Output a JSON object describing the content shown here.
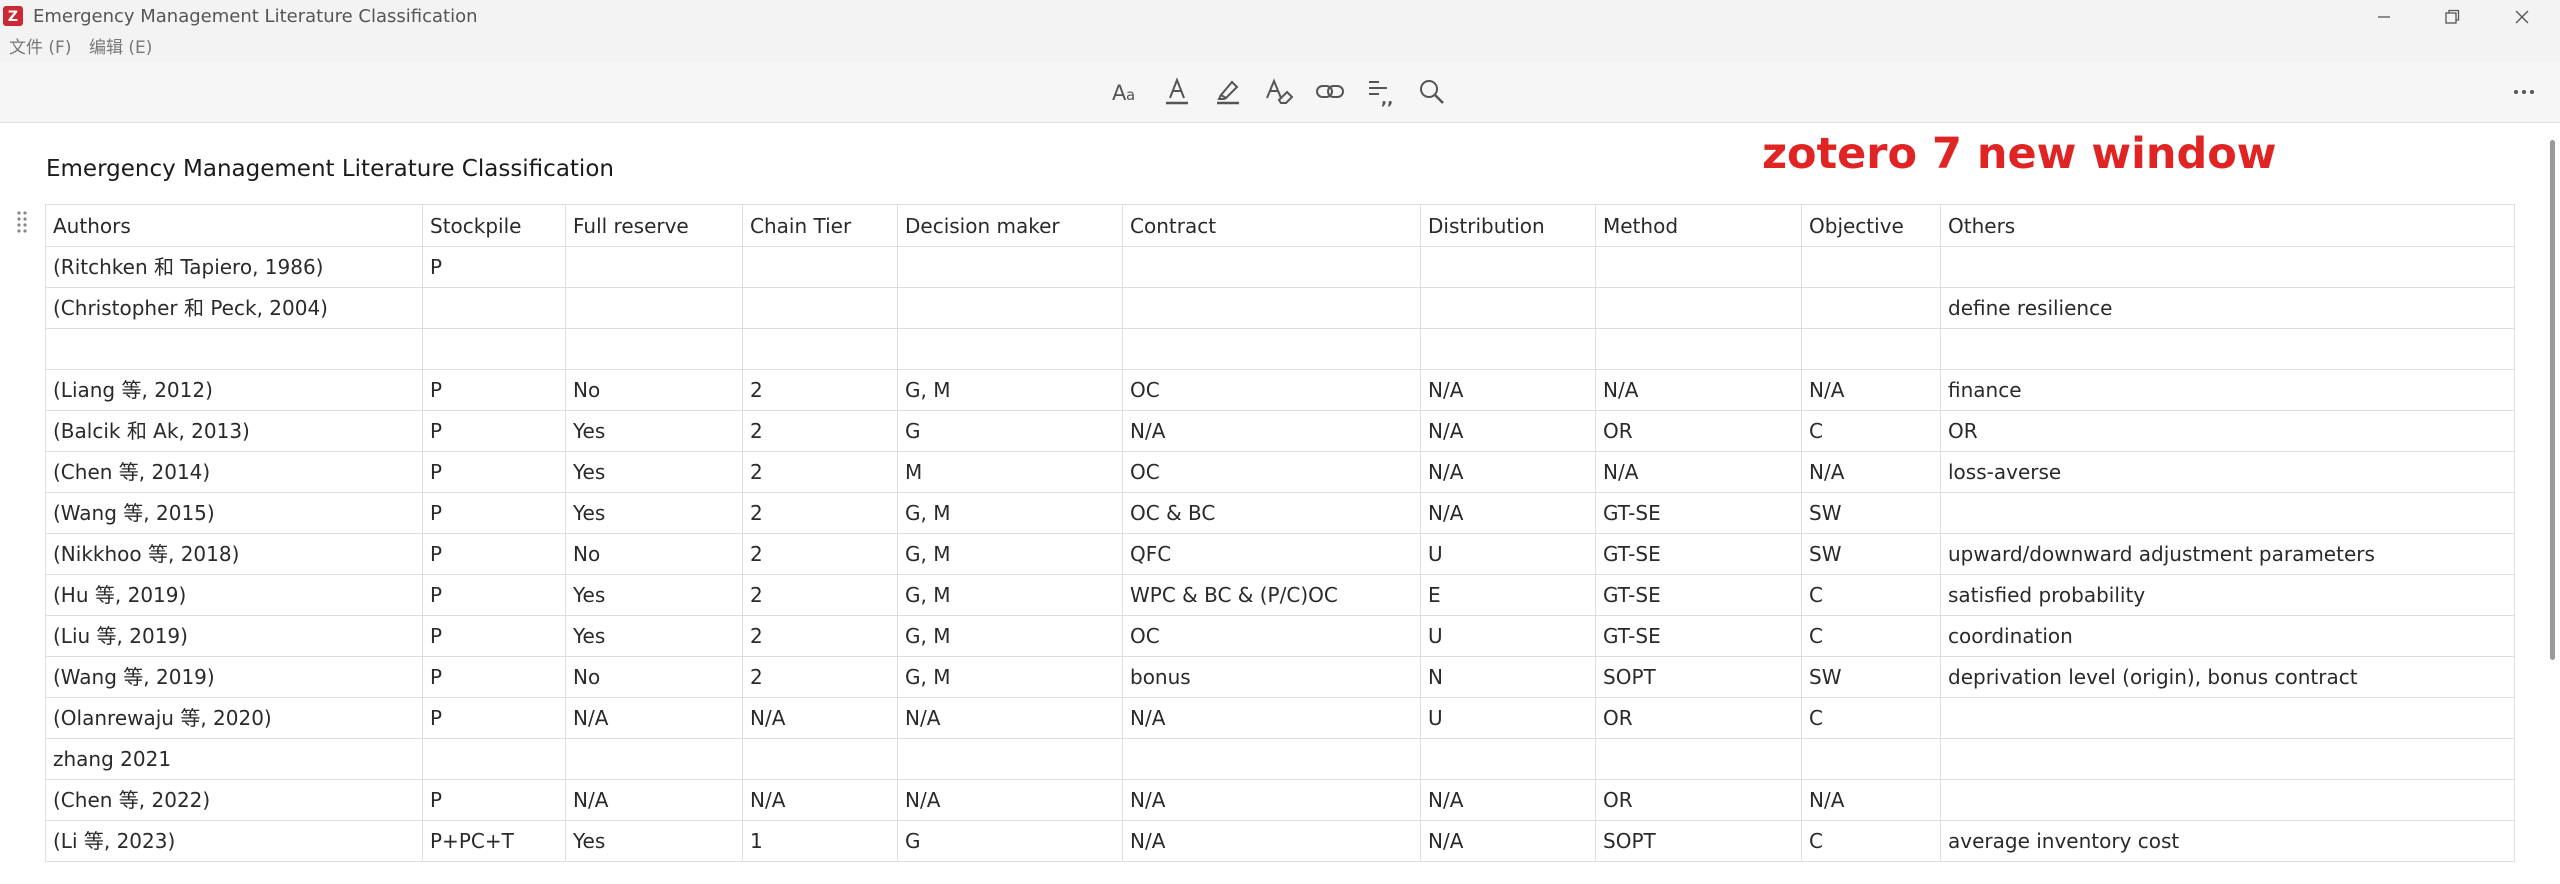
{
  "window": {
    "title": "Emergency Management Literature Classification",
    "logo_letter": "Z"
  },
  "menu": [
    "文件 (F)",
    "编辑 (E)"
  ],
  "toolbar": {
    "tools": [
      "font-size-icon",
      "text-color-icon",
      "highlight-icon",
      "clear-format-icon",
      "link-icon",
      "citation-icon",
      "search-icon"
    ],
    "more": "more-icon"
  },
  "document": {
    "heading": "Emergency Management Literature Classification",
    "annotation": "zotero 7 new window",
    "annotation_color": "#e02323"
  },
  "table": {
    "headers": [
      "Authors",
      "Stockpile",
      "Full reserve",
      "Chain Tier",
      "Decision maker",
      "Contract",
      "Distribution",
      "Method",
      "Objective",
      "Others"
    ],
    "rows": [
      [
        "(Ritchken 和 Tapiero, 1986)",
        "P",
        "",
        "",
        "",
        "",
        "",
        "",
        "",
        ""
      ],
      [
        "(Christopher 和 Peck, 2004)",
        "",
        "",
        "",
        "",
        "",
        "",
        "",
        "",
        "define resilience"
      ],
      [
        "",
        "",
        "",
        "",
        "",
        "",
        "",
        "",
        "",
        ""
      ],
      [
        "(Liang 等, 2012)",
        "P",
        "No",
        "2",
        "G, M",
        "OC",
        "N/A",
        "N/A",
        "N/A",
        "finance"
      ],
      [
        "(Balcik 和 Ak, 2013)",
        "P",
        "Yes",
        "2",
        "G",
        "N/A",
        "N/A",
        "OR",
        "C",
        "OR"
      ],
      [
        "(Chen 等, 2014)",
        "P",
        "Yes",
        "2",
        "M",
        "OC",
        "N/A",
        "N/A",
        "N/A",
        "loss-averse"
      ],
      [
        "(Wang 等, 2015)",
        "P",
        "Yes",
        "2",
        "G, M",
        "OC & BC",
        "N/A",
        "GT-SE",
        "SW",
        ""
      ],
      [
        "(Nikkhoo 等, 2018)",
        "P",
        "No",
        "2",
        "G, M",
        "QFC",
        "U",
        "GT-SE",
        "SW",
        "upward/downward adjustment parameters"
      ],
      [
        "(Hu 等, 2019)",
        "P",
        "Yes",
        "2",
        "G, M",
        "WPC & BC & (P/C)OC",
        "E",
        "GT-SE",
        "C",
        "satisfied probability"
      ],
      [
        "(Liu 等, 2019)",
        "P",
        "Yes",
        "2",
        "G, M",
        "OC",
        "U",
        "GT-SE",
        "C",
        "coordination"
      ],
      [
        "(Wang 等, 2019)",
        "P",
        "No",
        "2",
        "G, M",
        "bonus",
        "N",
        "SOPT",
        "SW",
        "deprivation level (origin), bonus contract"
      ],
      [
        "(Olanrewaju 等, 2020)",
        "P",
        "N/A",
        "N/A",
        "N/A",
        "N/A",
        "U",
        "OR",
        "C",
        ""
      ],
      [
        "zhang 2021",
        "",
        "",
        "",
        "",
        "",
        "",
        "",
        "",
        ""
      ],
      [
        "(Chen 等, 2022)",
        "P",
        "N/A",
        "N/A",
        "N/A",
        "N/A",
        "N/A",
        "OR",
        "N/A",
        ""
      ],
      [
        "(Li 等, 2023)",
        "P+PC+T",
        "Yes",
        "1",
        "G",
        "N/A",
        "N/A",
        "SOPT",
        "C",
        "average inventory cost"
      ]
    ]
  }
}
